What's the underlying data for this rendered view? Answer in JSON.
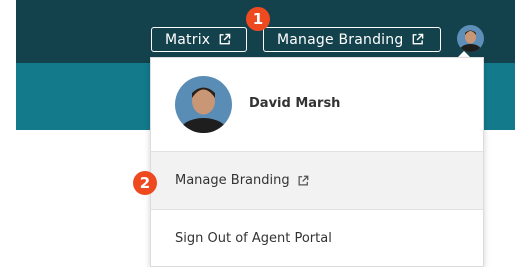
{
  "header": {
    "matrix_label": "Matrix",
    "branding_label": "Manage Branding",
    "user_avatar_icon": "user-avatar"
  },
  "annotations": {
    "badge_1": "1",
    "badge_2": "2"
  },
  "dropdown": {
    "user_name": "David Marsh",
    "items": [
      {
        "label": "Manage Branding",
        "icon": "external-link-icon"
      },
      {
        "label": "Sign Out of Agent Portal"
      }
    ]
  },
  "colors": {
    "topbar": "#14424c",
    "band": "#137a8c",
    "badge": "#ef4a1f",
    "highlight_row": "#f2f2f2"
  }
}
